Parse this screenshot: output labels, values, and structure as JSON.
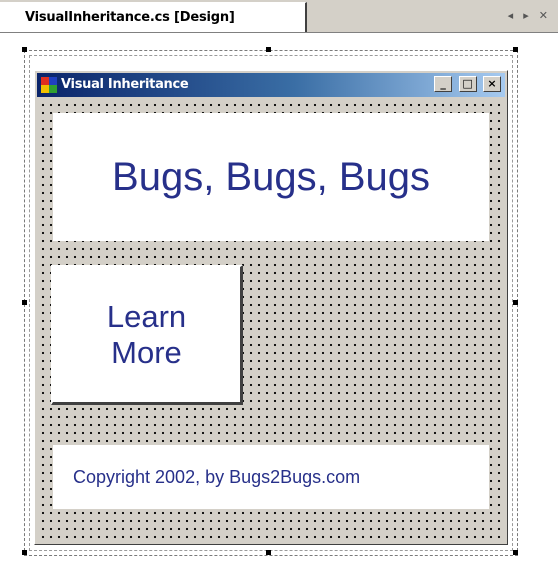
{
  "tab": {
    "title": "VisualInheritance.cs [Design]",
    "controls": [
      "◂",
      "▸",
      "✕"
    ]
  },
  "form": {
    "title": "Visual Inheritance",
    "buttons": {
      "minimize": "_",
      "maximize": "□",
      "close": "×"
    },
    "banner_text": "Bugs, Bugs, Bugs",
    "button_label_line1": "Learn",
    "button_label_line2": "More",
    "copyright_text": "Copyright 2002, by Bugs2Bugs.com"
  },
  "colors": {
    "text_navy": "#27308a",
    "titlebar_start": "#0a246a",
    "titlebar_end": "#a6caf0",
    "surface": "#d4d0c8"
  }
}
